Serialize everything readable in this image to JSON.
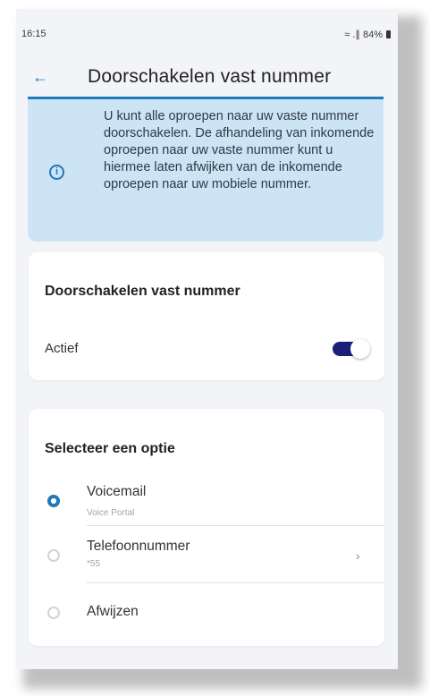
{
  "status": {
    "time": "16:15",
    "indicators": "≈ .∥ 84%"
  },
  "appbar": {
    "back_icon": "arrow-left",
    "title": "Doorschakelen vast nummer"
  },
  "info": {
    "icon": "info-icon",
    "text": "U kunt alle oproepen naar uw vaste nummer doorschakelen. De afhandeling van inkomende oproepen naar uw vaste nummer kunt u hiermee laten afwijken van de inkomende oproepen naar uw mobiele nummer."
  },
  "forward_card": {
    "heading": "Doorschakelen vast nummer",
    "active_label": "Actief",
    "active": true
  },
  "option_card": {
    "heading": "Selecteer een optie",
    "options": [
      {
        "label": "Voicemail",
        "sub": "Voice Portal",
        "selected": true
      },
      {
        "label": "Telefoonnummer",
        "sub": "*55",
        "selected": false,
        "chevron": "›"
      },
      {
        "label": "Afwijzen",
        "sub": "",
        "selected": false
      }
    ]
  },
  "colors": {
    "accent": "#1f7ab8",
    "info_bg": "#cde4f5",
    "toggle": "#1a1f7a",
    "page_bg": "#f3f4f8"
  }
}
